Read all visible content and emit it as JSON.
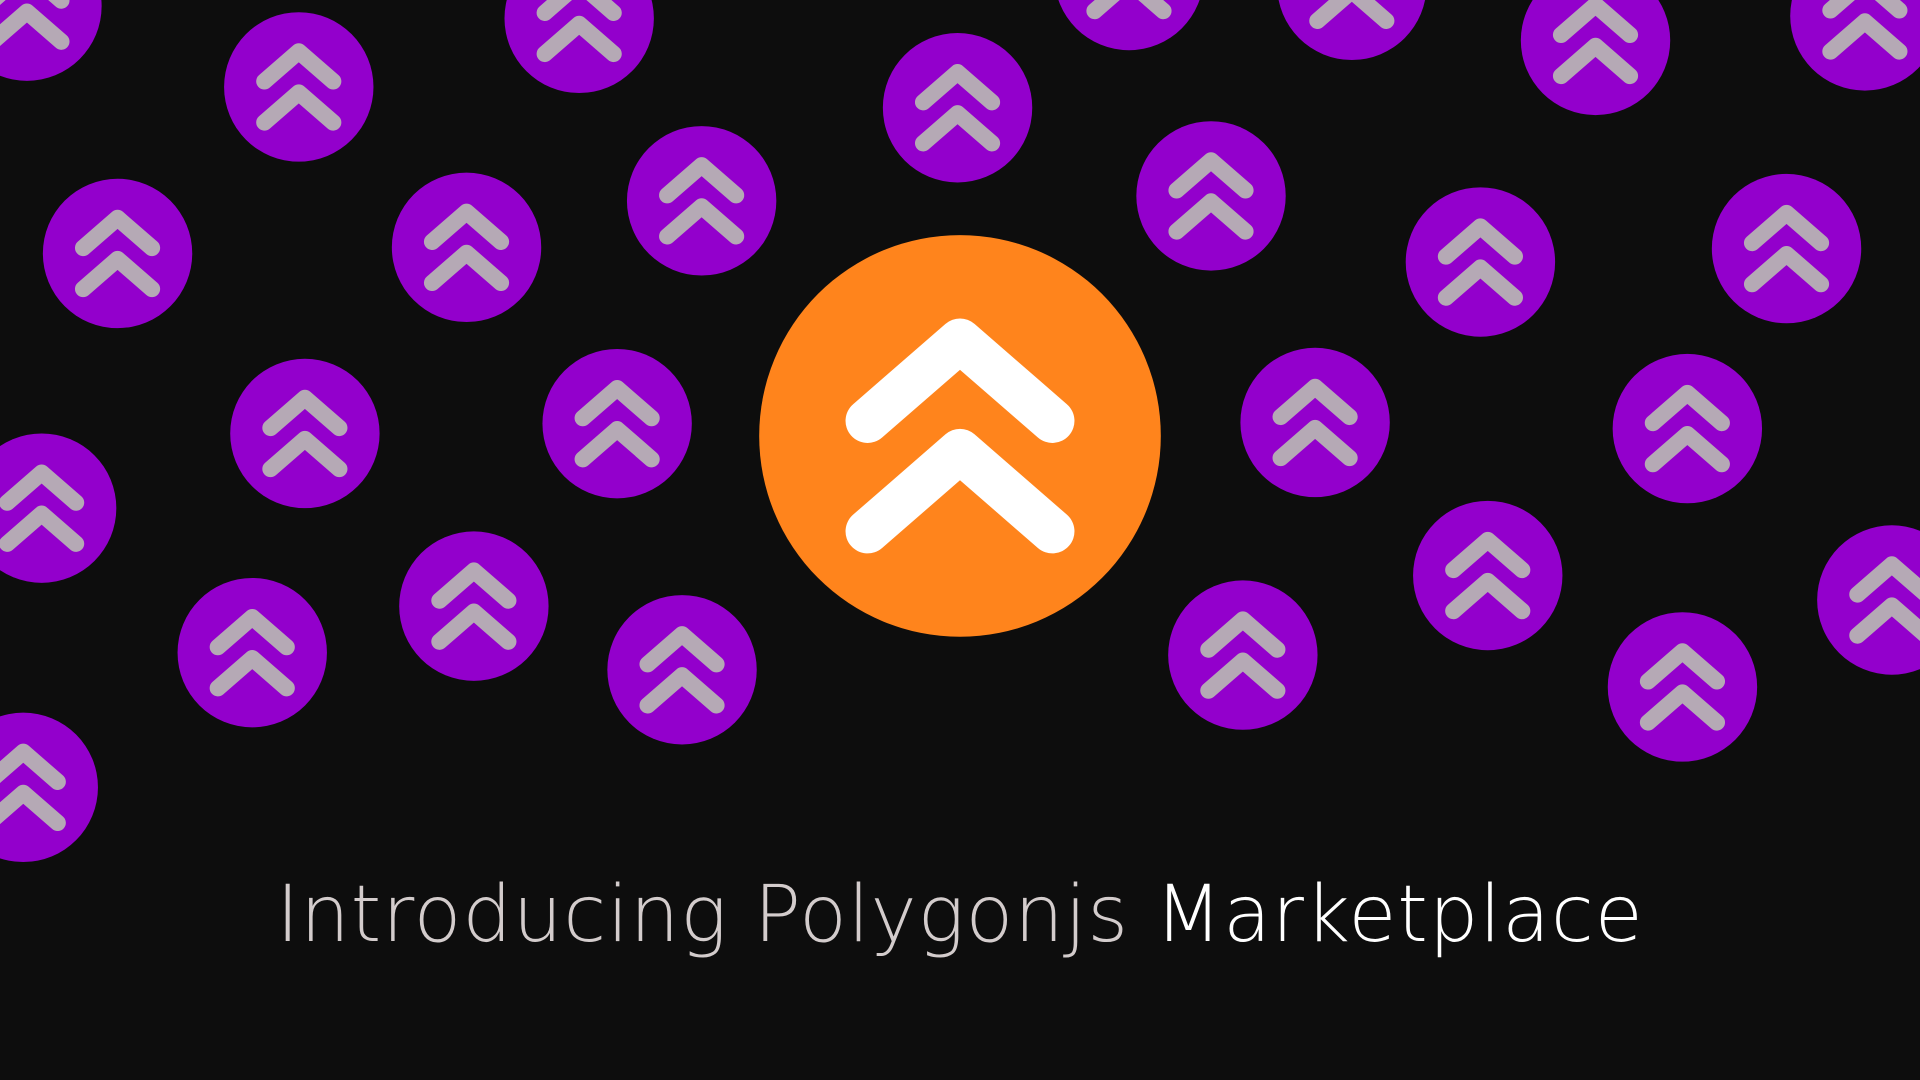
{
  "headline": {
    "lead": "Introducing Polygonjs",
    "tail": "Marketplace"
  },
  "icons": {
    "background": "double-chevron-up-icon",
    "center": "double-chevron-up-icon"
  },
  "colors": {
    "background": "#0d0d0d",
    "badge_purple": "#9300cc",
    "badge_chevron_gray": "#b5a9b5",
    "center_orange": "#ff841c",
    "center_chevron": "#ffffff",
    "headline_lead": "#d3cccc",
    "headline_tail": "#ffffff"
  }
}
